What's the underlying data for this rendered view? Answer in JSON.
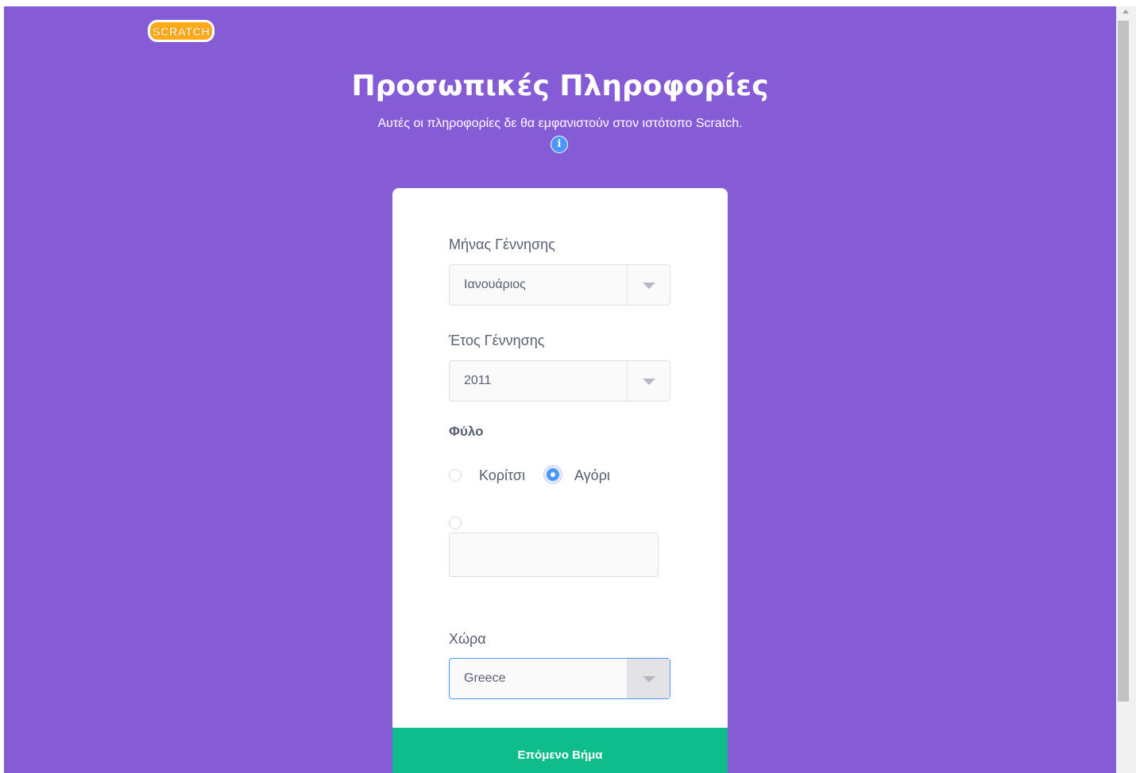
{
  "header": {
    "logo_text": "SCRATCH"
  },
  "main": {
    "title": "Προσωπικές Πληροφορίες",
    "subtitle": "Αυτές οι πληροφορίες δε θα εμφανιστούν στον ιστότοπο Scratch.",
    "info_glyph": "i"
  },
  "form": {
    "birth_month": {
      "label": "Μήνας Γέννησης",
      "value": "Ιανουάριος"
    },
    "birth_year": {
      "label": "Έτος Γέννησης",
      "value": "2011"
    },
    "gender": {
      "label": "Φύλο",
      "options": [
        {
          "label": "Κορίτσι",
          "checked": false
        },
        {
          "label": "Αγόρι",
          "checked": true
        }
      ],
      "custom_value": ""
    },
    "country": {
      "label": "Χώρα",
      "value": "Greece"
    },
    "next_label": "Επόμενο Βήμα"
  },
  "colors": {
    "background": "#855cd6",
    "button": "#0fbd8c",
    "accent": "#4c97ff",
    "logo": "#ffab19"
  }
}
